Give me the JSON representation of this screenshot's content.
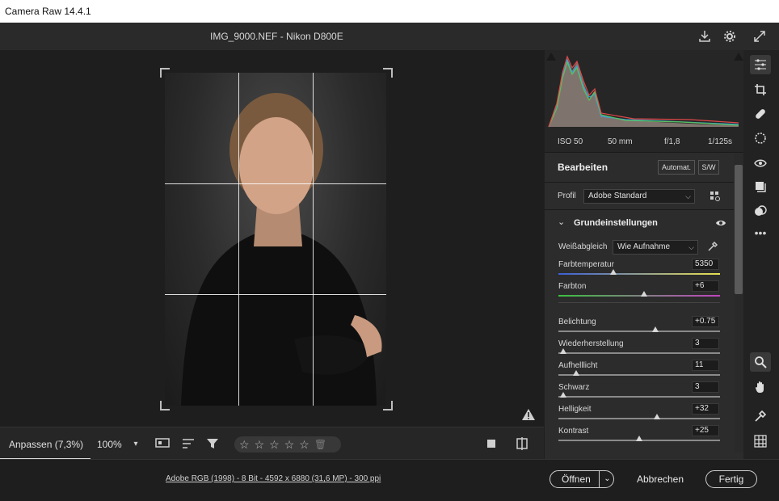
{
  "window": {
    "title": "Camera Raw 14.4.1"
  },
  "header": {
    "filename": "IMG_9000.NEF - Nikon D800E"
  },
  "histogram": {
    "iso": "ISO 50",
    "focal_length": "50 mm",
    "aperture": "f/1,8",
    "shutter": "1/125s"
  },
  "edit_panel": {
    "title": "Bearbeiten",
    "auto_label": "Automat.",
    "bw_label": "S/W",
    "profile_label": "Profil",
    "profile_value": "Adobe Standard",
    "basic_title": "Grundeinstellungen",
    "wb_label": "Weißabgleich",
    "wb_value": "Wie Aufnahme",
    "sliders": [
      {
        "label": "Farbtemperatur",
        "value": "5350",
        "position": 0.34
      },
      {
        "label": "Farbton",
        "value": "+6",
        "position": 0.53
      },
      {
        "label": "Belichtung",
        "value": "+0.75",
        "position": 0.6
      },
      {
        "label": "Wiederherstellung",
        "value": "3",
        "position": 0.03
      },
      {
        "label": "Aufhelllicht",
        "value": "11",
        "position": 0.11
      },
      {
        "label": "Schwarz",
        "value": "3",
        "position": 0.03
      },
      {
        "label": "Helligkeit",
        "value": "+32",
        "position": 0.61
      },
      {
        "label": "Kontrast",
        "value": "+25",
        "position": 0.5
      }
    ]
  },
  "bottom_bar": {
    "zoom_fit": "Anpassen (7,3%)",
    "zoom_pct": "100%"
  },
  "footer": {
    "info": "Adobe RGB (1998) - 8 Bit - 4592 x 6880 (31,6 MP) - 300 ppi",
    "open": "Öffnen",
    "cancel": "Abbrechen",
    "done": "Fertig"
  },
  "colors": {
    "accent": "#d8d8d8",
    "background": "#1f1f1f"
  }
}
